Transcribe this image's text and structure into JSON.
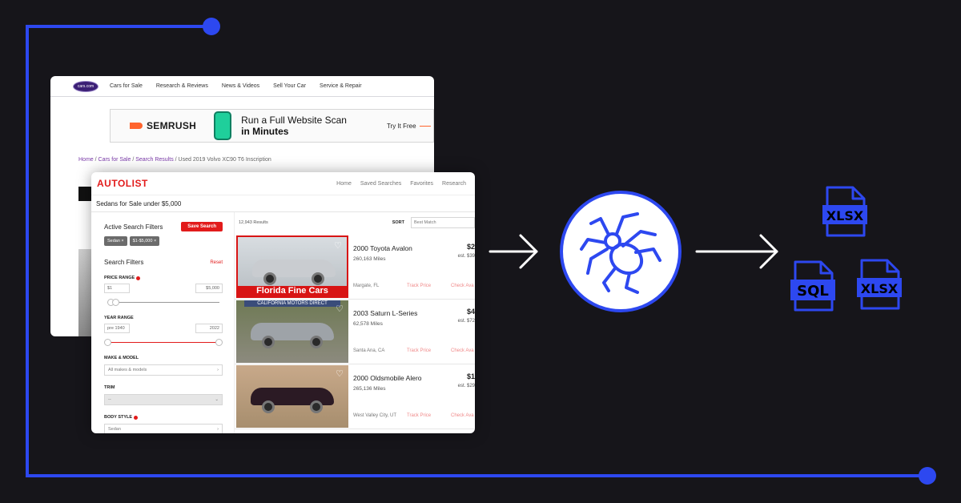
{
  "colors": {
    "accent": "#2d48f0",
    "background": "#16151a",
    "brand_red": "#e21b1b"
  },
  "cars_window": {
    "logo": "cars.com",
    "nav": [
      "Cars for Sale",
      "Research & Reviews",
      "News & Videos",
      "Sell Your Car",
      "Service & Repair"
    ],
    "ad": {
      "brand": "SEMRUSH",
      "headline": "Run a Full Website Scan",
      "headline_bold": "in Minutes",
      "cta": "Try It Free"
    },
    "breadcrumb": {
      "home": "Home",
      "sep": " / ",
      "cars": "Cars for Sale",
      "results": "Search Results",
      "current": "Used 2019 Volvo XC90 T6 Inscription"
    }
  },
  "autolist_window": {
    "logo": "AUTOLIST",
    "nav": [
      "Home",
      "Saved Searches",
      "Favorites",
      "Research"
    ],
    "page_title": "Sedans for Sale under $5,000",
    "active_filters_title": "Active Search Filters",
    "save_search_label": "Save Search",
    "chips": [
      "Sedan ×",
      "$1-$5,000 ×"
    ],
    "search_filters_title": "Search Filters",
    "reset_label": "Reset",
    "price_range": {
      "label": "PRICE RANGE",
      "min": "$1",
      "max": "$5,000"
    },
    "year_range": {
      "label": "YEAR RANGE",
      "min": "pre 1940",
      "max": "2022"
    },
    "make_model": {
      "label": "MAKE & MODEL",
      "placeholder": "All makes & models"
    },
    "trim": {
      "label": "TRIM",
      "value": "--"
    },
    "body_style": {
      "label": "BODY STYLE",
      "value": "Sedan"
    },
    "results_count": "12,943 Results",
    "sort_label": "SORT",
    "sort_value": "Best Match",
    "listings": [
      {
        "title": "2000 Toyota Avalon",
        "miles": "260,163 Miles",
        "price": "$2",
        "est": "est. $39",
        "location": "Margate, FL",
        "track": "Track Price",
        "check": "Check Ava",
        "banner": "Florida Fine Cars"
      },
      {
        "title": "2003 Saturn L-Series",
        "miles": "62,578 Miles",
        "price": "$4",
        "est": "est. $72",
        "location": "Santa Ana, CA",
        "track": "Track Price",
        "check": "Check Ava",
        "banner_top": "CALIFORNIA MOTORS DIRECT"
      },
      {
        "title": "2000 Oldsmobile Alero",
        "miles": "265,136 Miles",
        "price": "$1",
        "est": "est. $29",
        "location": "West Valley City, UT",
        "track": "Track Price",
        "check": "Check Ava"
      }
    ]
  },
  "icons": {
    "scraper": "spider-icon",
    "arrow": "arrow-right-icon"
  },
  "output_files": [
    "XLSX",
    "SQL",
    "XLSX"
  ]
}
